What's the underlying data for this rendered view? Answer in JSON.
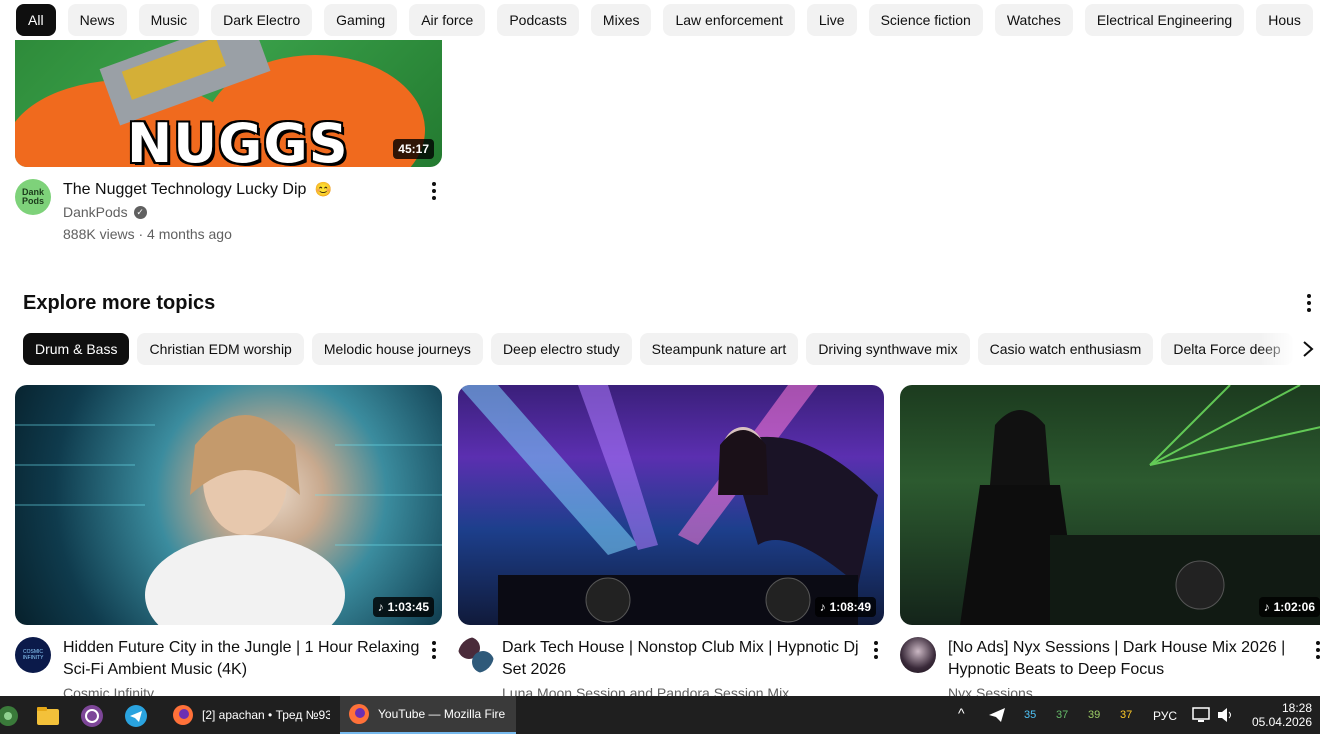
{
  "chips": [
    "All",
    "News",
    "Music",
    "Dark Electro",
    "Gaming",
    "Air force",
    "Podcasts",
    "Mixes",
    "Law enforcement",
    "Live",
    "Science fiction",
    "Watches",
    "Electrical Engineering",
    "Hous"
  ],
  "top_video": {
    "thumb_text": "NUGGS",
    "duration": "45:17",
    "title": "The Nugget Technology Lucky Dip",
    "emoji": "😊",
    "channel": "DankPods",
    "meta": "888K views · 4 months ago",
    "avatar_text": "Dank Pods"
  },
  "explore": {
    "title": "Explore more topics",
    "topics": [
      "Drum & Bass",
      "Christian EDM worship",
      "Melodic house journeys",
      "Deep electro study",
      "Steampunk nature art",
      "Driving synthwave mix",
      "Casio watch enthusiasm",
      "Delta Force deep"
    ]
  },
  "videos": [
    {
      "duration": "1:03:45",
      "title_line1": "Hidden Future City in the Jungle | 1 Hour Relaxing",
      "title_line2": "Sci-Fi Ambient Music (4K)",
      "channel": "Cosmic Infinity",
      "avatar_text": "COSMIC INFINITY"
    },
    {
      "duration": "1:08:49",
      "title_line1": "Dark Tech House | Nonstop Club Mix | Hypnotic Dj",
      "title_line2": "Set 2026",
      "channel": "Luna Moon Session and Pandora Session Mix"
    },
    {
      "duration": "1:02:06",
      "title_line1": "[No Ads] Nyx Sessions | Dark House Mix 2026 |",
      "title_line2": "Hypnotic Beats to Deep Focus",
      "channel": "Nyx Sessions"
    }
  ],
  "taskbar": {
    "tasks": [
      "[2] apachan • Тред №93",
      "YouTube — Mozilla Fire"
    ],
    "tray_numbers": [
      "35",
      "37",
      "39",
      "37"
    ],
    "tray_number_colors": [
      "#4fc3f7",
      "#66bb6a",
      "#9ccc65",
      "#ffca28"
    ],
    "lang": "РУС",
    "time": "18:28",
    "date": "05.04.2026"
  }
}
